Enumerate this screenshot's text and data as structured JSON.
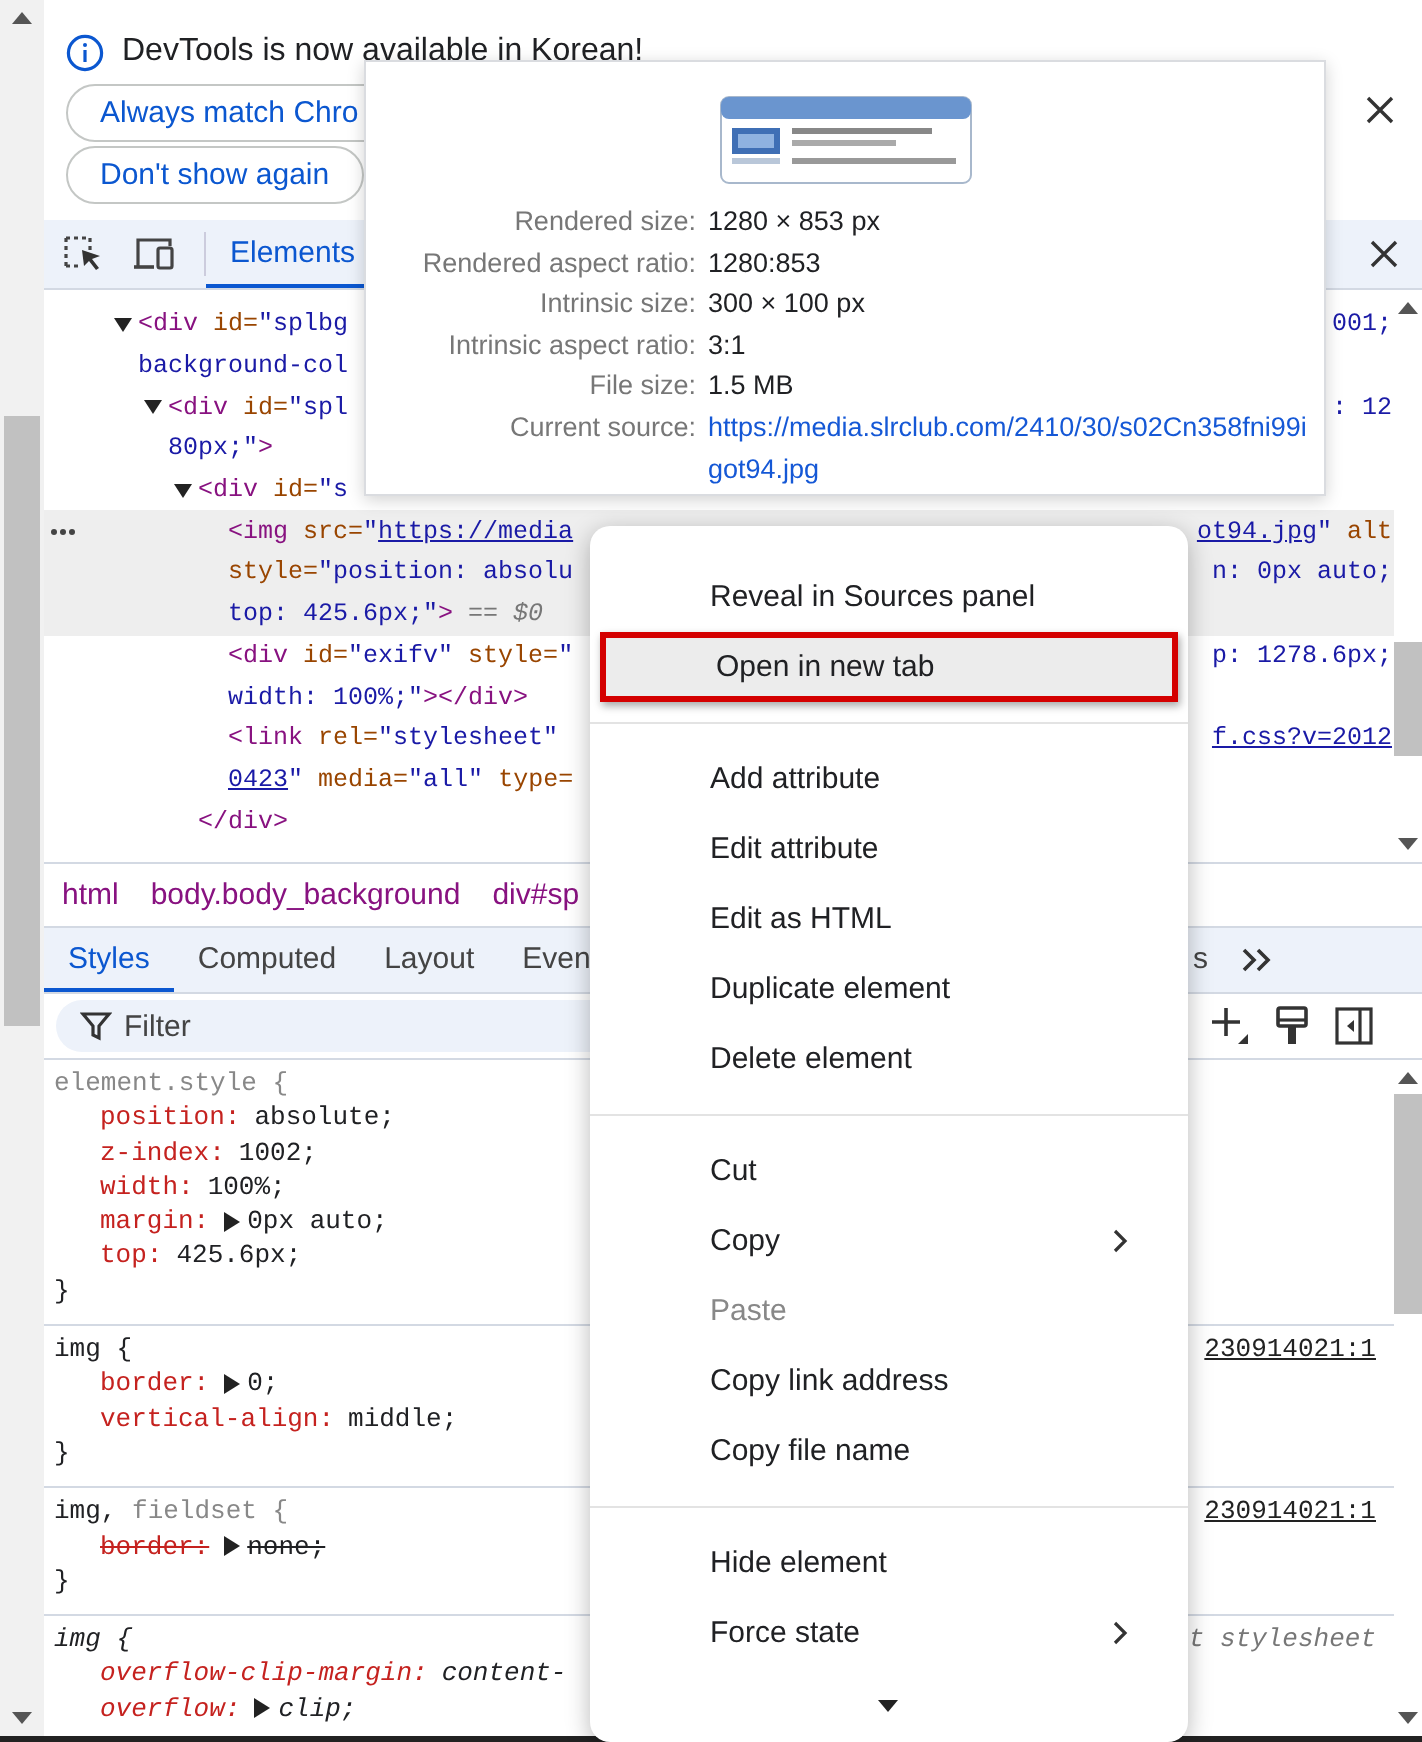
{
  "infobar": {
    "message": "DevTools is now available in Korean!",
    "buttons": [
      "Always match Chro",
      "Don't show again"
    ]
  },
  "toolbar": {
    "tabs": [
      {
        "label": "Elements",
        "selected": true
      }
    ]
  },
  "elements_tree": [
    {
      "expanded": true,
      "selected": false,
      "lines": [
        {
          "segments": [
            {
              "text": "<div ",
              "kind": "tag"
            },
            {
              "text": "id=",
              "kind": "attr"
            },
            {
              "text": "\"splbg",
              "kind": "val"
            }
          ],
          "right": [
            {
              "text": "001;",
              "kind": "val"
            }
          ]
        },
        {
          "segments": [
            {
              "text": "background-col",
              "kind": "val"
            }
          ]
        }
      ],
      "children": [
        {
          "expanded": true,
          "selected": false,
          "lines": [
            {
              "segments": [
                {
                  "text": "<div ",
                  "kind": "tag"
                },
                {
                  "text": "id=",
                  "kind": "attr"
                },
                {
                  "text": "\"spl",
                  "kind": "val"
                }
              ],
              "right": [
                {
                  "text": ": 12",
                  "kind": "val"
                }
              ]
            },
            {
              "segments": [
                {
                  "text": "80px;\"",
                  "kind": "val"
                },
                {
                  "text": ">",
                  "kind": "tag"
                }
              ]
            }
          ],
          "children": [
            {
              "expanded": true,
              "selected": false,
              "lines": [
                {
                  "segments": [
                    {
                      "text": "<div ",
                      "kind": "tag"
                    },
                    {
                      "text": "id=",
                      "kind": "attr"
                    },
                    {
                      "text": "\"s",
                      "kind": "val"
                    }
                  ]
                }
              ],
              "closing": [
                {
                  "text": "</div>",
                  "kind": "tag"
                }
              ],
              "children": [
                {
                  "selected": true,
                  "lines": [
                    {
                      "segments": [
                        {
                          "text": "<img ",
                          "kind": "tag"
                        },
                        {
                          "text": "src=",
                          "kind": "attr"
                        },
                        {
                          "text": "\"",
                          "kind": "val"
                        },
                        {
                          "text": "https://media",
                          "kind": "link"
                        }
                      ],
                      "right": [
                        {
                          "text": "ot94.jpg",
                          "kind": "link"
                        },
                        {
                          "text": "\" ",
                          "kind": "val"
                        },
                        {
                          "text": "alt",
                          "kind": "attr"
                        }
                      ]
                    },
                    {
                      "segments": [
                        {
                          "text": "style=",
                          "kind": "attr"
                        },
                        {
                          "text": "\"position: absolu",
                          "kind": "val"
                        }
                      ],
                      "right": [
                        {
                          "text": "n: 0px auto;",
                          "kind": "val"
                        }
                      ]
                    },
                    {
                      "segments": [
                        {
                          "text": "top: 425.6px;\"",
                          "kind": "val"
                        },
                        {
                          "text": ">",
                          "kind": "tag"
                        },
                        {
                          "text": " == $0",
                          "kind": "dim"
                        }
                      ]
                    }
                  ]
                },
                {
                  "selected": false,
                  "lines": [
                    {
                      "segments": [
                        {
                          "text": "<div ",
                          "kind": "tag"
                        },
                        {
                          "text": "id=",
                          "kind": "attr"
                        },
                        {
                          "text": "\"exifv\" ",
                          "kind": "val"
                        },
                        {
                          "text": "style=",
                          "kind": "attr"
                        },
                        {
                          "text": "\"",
                          "kind": "val"
                        }
                      ],
                      "right": [
                        {
                          "text": "p: 1278.6px;",
                          "kind": "val"
                        }
                      ]
                    },
                    {
                      "segments": [
                        {
                          "text": "width: 100%;\"",
                          "kind": "val"
                        },
                        {
                          "text": "></div>",
                          "kind": "tag"
                        }
                      ]
                    }
                  ]
                },
                {
                  "selected": false,
                  "lines": [
                    {
                      "segments": [
                        {
                          "text": "<link ",
                          "kind": "tag"
                        },
                        {
                          "text": "rel=",
                          "kind": "attr"
                        },
                        {
                          "text": "\"stylesheet\"",
                          "kind": "val"
                        }
                      ],
                      "right": [
                        {
                          "text": "f.css?v=2012",
                          "kind": "link"
                        }
                      ]
                    },
                    {
                      "segments": [
                        {
                          "text": "0423",
                          "kind": "link"
                        },
                        {
                          "text": "\" ",
                          "kind": "val"
                        },
                        {
                          "text": "media=",
                          "kind": "attr"
                        },
                        {
                          "text": "\"all\" ",
                          "kind": "val"
                        },
                        {
                          "text": "type=",
                          "kind": "attr"
                        }
                      ]
                    }
                  ]
                }
              ]
            }
          ]
        }
      ]
    }
  ],
  "breadcrumbs": [
    "html",
    "body.body_background",
    "div#sp"
  ],
  "sidebar_tabs": [
    {
      "label": "Styles",
      "selected": true
    },
    {
      "label": "Computed",
      "selected": false
    },
    {
      "label": "Layout",
      "selected": false
    },
    {
      "label": "Even",
      "selected": false
    },
    {
      "label": "s",
      "selected": false
    }
  ],
  "filter": {
    "placeholder": "Filter"
  },
  "style_rules": [
    {
      "kind": "inline",
      "selector": [
        {
          "text": "element.style {",
          "matched": false
        }
      ],
      "props": [
        {
          "name": "position:",
          "value": "absolute;",
          "expandable": false,
          "overridden": false
        },
        {
          "name": "z-index:",
          "value": "1002;",
          "expandable": false,
          "overridden": false
        },
        {
          "name": "width:",
          "value": "100%;",
          "expandable": false,
          "overridden": false
        },
        {
          "name": "margin:",
          "value": "0px auto;",
          "expandable": true,
          "overridden": false
        },
        {
          "name": "top:",
          "value": "425.6px;",
          "expandable": false,
          "overridden": false
        }
      ],
      "close": "}"
    },
    {
      "kind": "author",
      "selector": [
        {
          "text": "img {",
          "matched": true
        }
      ],
      "source": "230914021:1",
      "props": [
        {
          "name": "border:",
          "value": "0;",
          "expandable": true,
          "overridden": false
        },
        {
          "name": "vertical-align:",
          "value": "middle;",
          "expandable": false,
          "overridden": false
        }
      ],
      "close": "}"
    },
    {
      "kind": "author",
      "selector": [
        {
          "text": "img,",
          "matched": true
        },
        {
          "text": " fieldset {",
          "matched": false
        }
      ],
      "source": "230914021:1",
      "props": [
        {
          "name": "border:",
          "value": "none;",
          "expandable": true,
          "overridden": true
        }
      ],
      "close": "}"
    },
    {
      "kind": "user-agent",
      "selector": [
        {
          "text": "img {",
          "matched": true
        }
      ],
      "source": "t stylesheet",
      "props": [
        {
          "name": "overflow-clip-margin:",
          "value": "content-",
          "expandable": false,
          "overridden": false
        },
        {
          "name": "overflow:",
          "value": "clip;",
          "expandable": true,
          "overridden": false
        }
      ]
    }
  ],
  "tooltip": {
    "rows": [
      {
        "label": "Rendered size:",
        "value": "1280 × 853 px",
        "kind": "text"
      },
      {
        "label": "Rendered aspect ratio:",
        "value": "1280:853",
        "kind": "text"
      },
      {
        "label": "Intrinsic size:",
        "value": "300 × 100 px",
        "kind": "text"
      },
      {
        "label": "Intrinsic aspect ratio:",
        "value": "3:1",
        "kind": "text"
      },
      {
        "label": "File size:",
        "value": "1.5 MB",
        "kind": "text"
      },
      {
        "label": "Current source:",
        "value": "https://media.slrclub.com/2410/30/s02Cn358fni99igot94.jpg",
        "kind": "link"
      }
    ]
  },
  "context_menu": {
    "groups": [
      {
        "items": [
          {
            "label": "Reveal in Sources panel",
            "selected": false,
            "disabled": false,
            "submenu": false
          },
          {
            "label": "Open in new tab",
            "selected": true,
            "disabled": false,
            "submenu": false
          }
        ]
      },
      {
        "items": [
          {
            "label": "Add attribute",
            "selected": false,
            "disabled": false,
            "submenu": false
          },
          {
            "label": "Edit attribute",
            "selected": false,
            "disabled": false,
            "submenu": false
          },
          {
            "label": "Edit as HTML",
            "selected": false,
            "disabled": false,
            "submenu": false
          },
          {
            "label": "Duplicate element",
            "selected": false,
            "disabled": false,
            "submenu": false
          },
          {
            "label": "Delete element",
            "selected": false,
            "disabled": false,
            "submenu": false
          }
        ]
      },
      {
        "items": [
          {
            "label": "Cut",
            "selected": false,
            "disabled": false,
            "submenu": false
          },
          {
            "label": "Copy",
            "selected": false,
            "disabled": false,
            "submenu": true
          },
          {
            "label": "Paste",
            "selected": false,
            "disabled": true,
            "submenu": false
          },
          {
            "label": "Copy link address",
            "selected": false,
            "disabled": false,
            "submenu": false
          },
          {
            "label": "Copy file name",
            "selected": false,
            "disabled": false,
            "submenu": false
          }
        ]
      },
      {
        "items": [
          {
            "label": "Hide element",
            "selected": false,
            "disabled": false,
            "submenu": false
          },
          {
            "label": "Force state",
            "selected": false,
            "disabled": false,
            "submenu": true
          }
        ]
      }
    ]
  }
}
